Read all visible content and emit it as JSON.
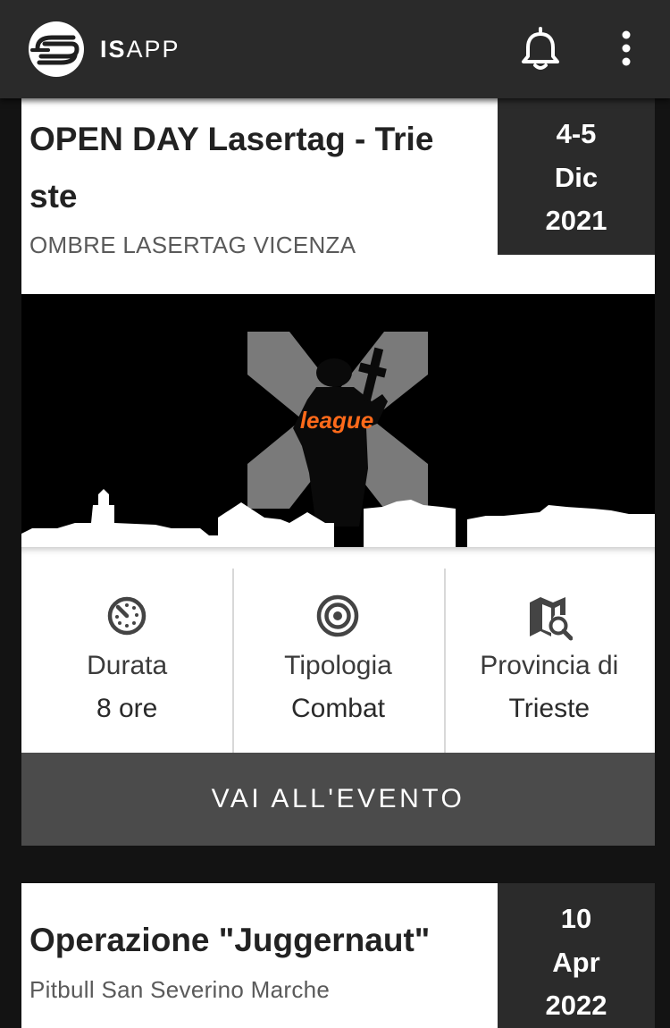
{
  "app": {
    "title_bold": "IS",
    "title_light": "APP",
    "logo_icon": "isapp-logo-icon",
    "notification_icon": "bell-icon",
    "menu_icon": "more-vert-icon"
  },
  "events": [
    {
      "title": "OPEN DAY Lasertag - Trieste",
      "organizer": "OMBRE LASERTAG VICENZA",
      "date": {
        "day": "4-5",
        "month": "Dic",
        "year": "2021"
      },
      "banner_text": "league",
      "info": [
        {
          "icon": "timer-icon",
          "label": "Durata",
          "value": "8 ore"
        },
        {
          "icon": "target-icon",
          "label": "Tipologia",
          "value": "Combat"
        },
        {
          "icon": "map-search-icon",
          "label": "Provincia di",
          "value": "Trieste"
        }
      ],
      "cta_label": "VAI ALL'EVENTO"
    },
    {
      "title": "Operazione \"Juggernaut\"",
      "organizer": "Pitbull San Severino Marche",
      "date": {
        "day": "10",
        "month": "Apr",
        "year": "2022"
      }
    }
  ],
  "colors": {
    "background": "#131313",
    "topbar": "#2a2a2a",
    "date_box": "#2b2b2b",
    "cta": "#4b4b4b",
    "accent_orange": "#ff6a1a"
  }
}
